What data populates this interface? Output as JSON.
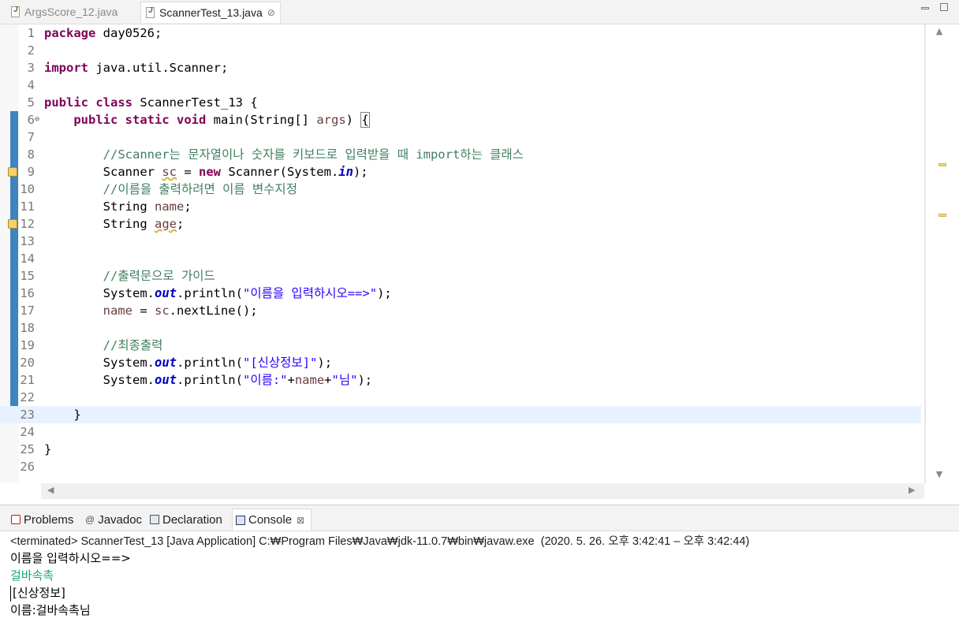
{
  "editor_tabs": [
    {
      "label": "ArgsScore_12.java",
      "active": false
    },
    {
      "label": "ScannerTest_13.java",
      "active": true,
      "close": "⊘"
    }
  ],
  "code_lines": [
    {
      "num": "1",
      "text": "package day0526;"
    },
    {
      "num": "2",
      "text": ""
    },
    {
      "num": "3",
      "text": "import java.util.Scanner;"
    },
    {
      "num": "4",
      "text": ""
    },
    {
      "num": "5",
      "text": "public class ScannerTest_13 {"
    },
    {
      "num": "6",
      "text": "    public static void main(String[] args) {"
    },
    {
      "num": "7",
      "text": ""
    },
    {
      "num": "8",
      "text": "        //Scanner는 문자열이나 숫자를 키보드로 입력받을 때 import하는 클래스"
    },
    {
      "num": "9",
      "text": "        Scanner sc = new Scanner(System.in);"
    },
    {
      "num": "10",
      "text": "        //이름을 출력하려면 이름 변수지정"
    },
    {
      "num": "11",
      "text": "        String name;"
    },
    {
      "num": "12",
      "text": "        String age;"
    },
    {
      "num": "13",
      "text": ""
    },
    {
      "num": "14",
      "text": ""
    },
    {
      "num": "15",
      "text": "        //출력문으로 가이드"
    },
    {
      "num": "16",
      "text": "        System.out.println(\"이름을 입력하시오==>\");"
    },
    {
      "num": "17",
      "text": "        name = sc.nextLine();"
    },
    {
      "num": "18",
      "text": ""
    },
    {
      "num": "19",
      "text": "        //최종출력"
    },
    {
      "num": "20",
      "text": "        System.out.println(\"[신상정보]\");"
    },
    {
      "num": "21",
      "text": "        System.out.println(\"이름:\"+name+\"님\");"
    },
    {
      "num": "22",
      "text": ""
    },
    {
      "num": "23",
      "text": "    }"
    },
    {
      "num": "24",
      "text": ""
    },
    {
      "num": "25",
      "text": "}"
    },
    {
      "num": "26",
      "text": ""
    }
  ],
  "current_line": 23,
  "panel_tabs": [
    {
      "label": "Problems",
      "icon": "problems-icon"
    },
    {
      "label": "Javadoc",
      "icon": "javadoc-icon"
    },
    {
      "label": "Declaration",
      "icon": "declaration-icon"
    },
    {
      "label": "Console",
      "icon": "console-icon",
      "active": true
    }
  ],
  "console": {
    "header": "<terminated> ScannerTest_13 [Java Application] C:₩Program Files₩Java₩jdk-11.0.7₩bin₩javaw.exe  (2020. 5. 26. 오후 3:42:41 – 오후 3:42:44)",
    "lines": [
      {
        "text": "이름을 입력하시오==>",
        "kind": "out"
      },
      {
        "text": "걸바속촉",
        "kind": "in"
      },
      {
        "text": "[신상정보]",
        "kind": "out"
      },
      {
        "text": "이름:걸바속촉님",
        "kind": "out"
      }
    ]
  },
  "colors": {
    "keyword": "#7f0055",
    "comment": "#3f7f5f",
    "string": "#2a00ff",
    "field": "#0000c0",
    "local_var": "#6a3e3e",
    "console_input": "#13a873",
    "current_line_bg": "#e8f2fe"
  }
}
